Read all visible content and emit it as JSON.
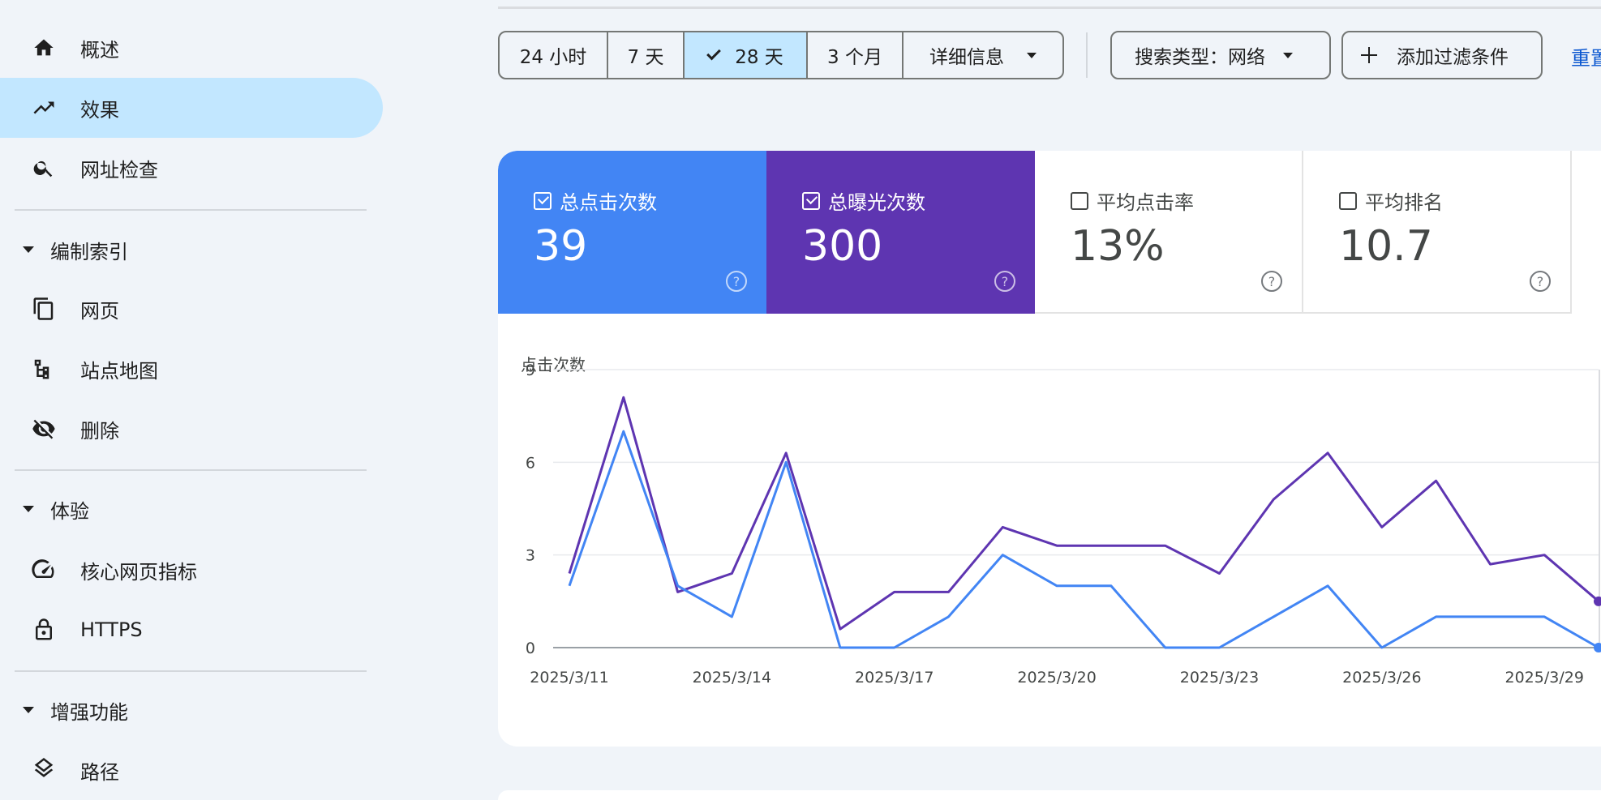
{
  "sidebar": {
    "items": [
      {
        "label": "概述",
        "icon": "home-icon"
      },
      {
        "label": "效果",
        "icon": "trending-up-icon",
        "active": true
      },
      {
        "label": "网址检查",
        "icon": "search-icon"
      }
    ],
    "sections": [
      {
        "label": "编制索引",
        "items": [
          {
            "label": "网页",
            "icon": "pages-icon"
          },
          {
            "label": "站点地图",
            "icon": "sitemap-icon"
          },
          {
            "label": "删除",
            "icon": "visibility-off-icon"
          }
        ]
      },
      {
        "label": "体验",
        "items": [
          {
            "label": "核心网页指标",
            "icon": "speed-gauge-icon"
          },
          {
            "label": "HTTPS",
            "icon": "lock-icon"
          }
        ]
      },
      {
        "label": "增强功能",
        "items": [
          {
            "label": "路径",
            "icon": "layers-icon"
          }
        ]
      }
    ]
  },
  "toolbar": {
    "ranges": [
      "24 小时",
      "7 天",
      "28 天",
      "3 个月"
    ],
    "selected_range": "28 天",
    "details_label": "详细信息",
    "search_type_label": "搜索类型：网络",
    "add_filter_label": "添加过滤条件",
    "reset_label": "重置"
  },
  "metrics": {
    "clicks": {
      "label": "总点击次数",
      "value": "39",
      "checked": true,
      "color": "#4285f4"
    },
    "impressions": {
      "label": "总曝光次数",
      "value": "300",
      "checked": true,
      "color": "#5e35b1"
    },
    "ctr": {
      "label": "平均点击率",
      "value": "13%",
      "checked": false
    },
    "position": {
      "label": "平均排名",
      "value": "10.7",
      "checked": false
    }
  },
  "chart_data": {
    "type": "line",
    "ylabel": "点击次数",
    "ylim": [
      0,
      9
    ],
    "yticks": [
      0,
      3,
      6,
      9
    ],
    "x_tick_labels": [
      "2025/3/11",
      "2025/3/14",
      "2025/3/17",
      "2025/3/20",
      "2025/3/23",
      "2025/3/26",
      "2025/3/29"
    ],
    "x": [
      "2025/3/11",
      "2025/3/12",
      "2025/3/13",
      "2025/3/14",
      "2025/3/15",
      "2025/3/16",
      "2025/3/17",
      "2025/3/18",
      "2025/3/19",
      "2025/3/20",
      "2025/3/21",
      "2025/3/22",
      "2025/3/23",
      "2025/3/24",
      "2025/3/25",
      "2025/3/26",
      "2025/3/27",
      "2025/3/28",
      "2025/3/29",
      "2025/3/30"
    ],
    "series": [
      {
        "color": "#5e35b1",
        "values": [
          2.4,
          8.1,
          1.8,
          2.4,
          6.3,
          0.6,
          1.8,
          1.8,
          3.9,
          3.3,
          3.3,
          3.3,
          2.4,
          4.8,
          6.3,
          3.9,
          5.4,
          2.7,
          3.0,
          1.5
        ]
      },
      {
        "color": "#4285f4",
        "values": [
          2,
          7,
          2,
          1,
          6,
          0,
          0,
          1,
          3,
          2,
          2,
          0,
          0,
          1,
          2,
          0,
          1,
          1,
          1,
          0
        ]
      }
    ]
  }
}
